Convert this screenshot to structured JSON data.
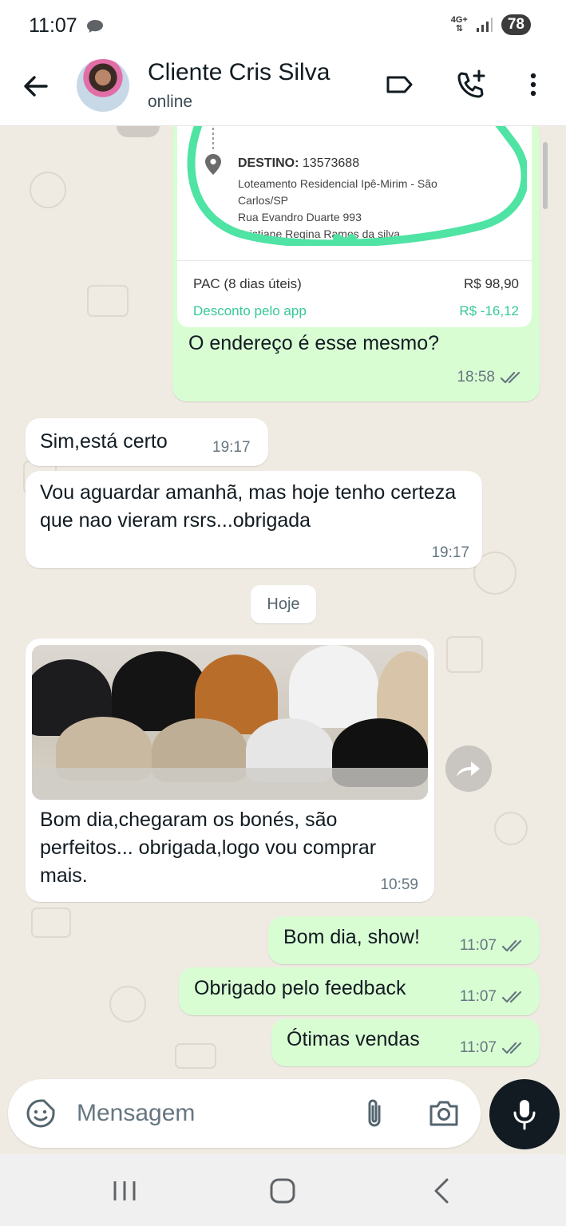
{
  "status_bar": {
    "time": "11:07",
    "network": "4G+",
    "battery": "78",
    "icons": [
      "chat-notification-icon",
      "signal-icon"
    ]
  },
  "header": {
    "contact_name": "Cliente Cris Silva",
    "status": "online",
    "icons": [
      "back-arrow-icon",
      "label-icon",
      "add-call-icon",
      "more-vert-icon"
    ]
  },
  "messages": {
    "shipping_card": {
      "destino_label": "DESTINO:",
      "destino_cep": "13573688",
      "address_line1": "Loteamento Residencial Ipê-Mirim - São Carlos/SP",
      "address_line2": "Rua Evandro Duarte 993",
      "address_line3": "Cristiane Regina Ramos da silva",
      "shipping_option": "PAC (8 dias úteis)",
      "shipping_price": "R$ 98,90",
      "discount_label": "Desconto pelo app",
      "discount_value": "R$ -16,12"
    },
    "m1": {
      "text": "O endereço é esse mesmo?",
      "time": "18:58"
    },
    "m2": {
      "text": "Sim,está certo",
      "time": "19:17"
    },
    "m3": {
      "text": "Vou aguardar amanhã, mas hoje tenho certeza que nao vieram rsrs...obrigada",
      "time": "19:17"
    },
    "date_divider": "Hoje",
    "m4": {
      "text": "Bom dia,chegaram os bonés, são perfeitos... obrigada,logo vou comprar mais.",
      "time": "10:59"
    },
    "m5": {
      "text": "Bom dia, show!",
      "time": "11:07"
    },
    "m6": {
      "text": "Obrigado pelo feedback",
      "time": "11:07"
    },
    "m7": {
      "text": "Ótimas vendas",
      "time": "11:07"
    }
  },
  "input": {
    "placeholder": "Mensagem"
  },
  "colors": {
    "outgoing_bubble": "#d9fdd3",
    "incoming_bubble": "#ffffff",
    "chat_bg": "#efeae2",
    "tick_read": "#667781",
    "highlight_circle": "#4fe3a4"
  }
}
